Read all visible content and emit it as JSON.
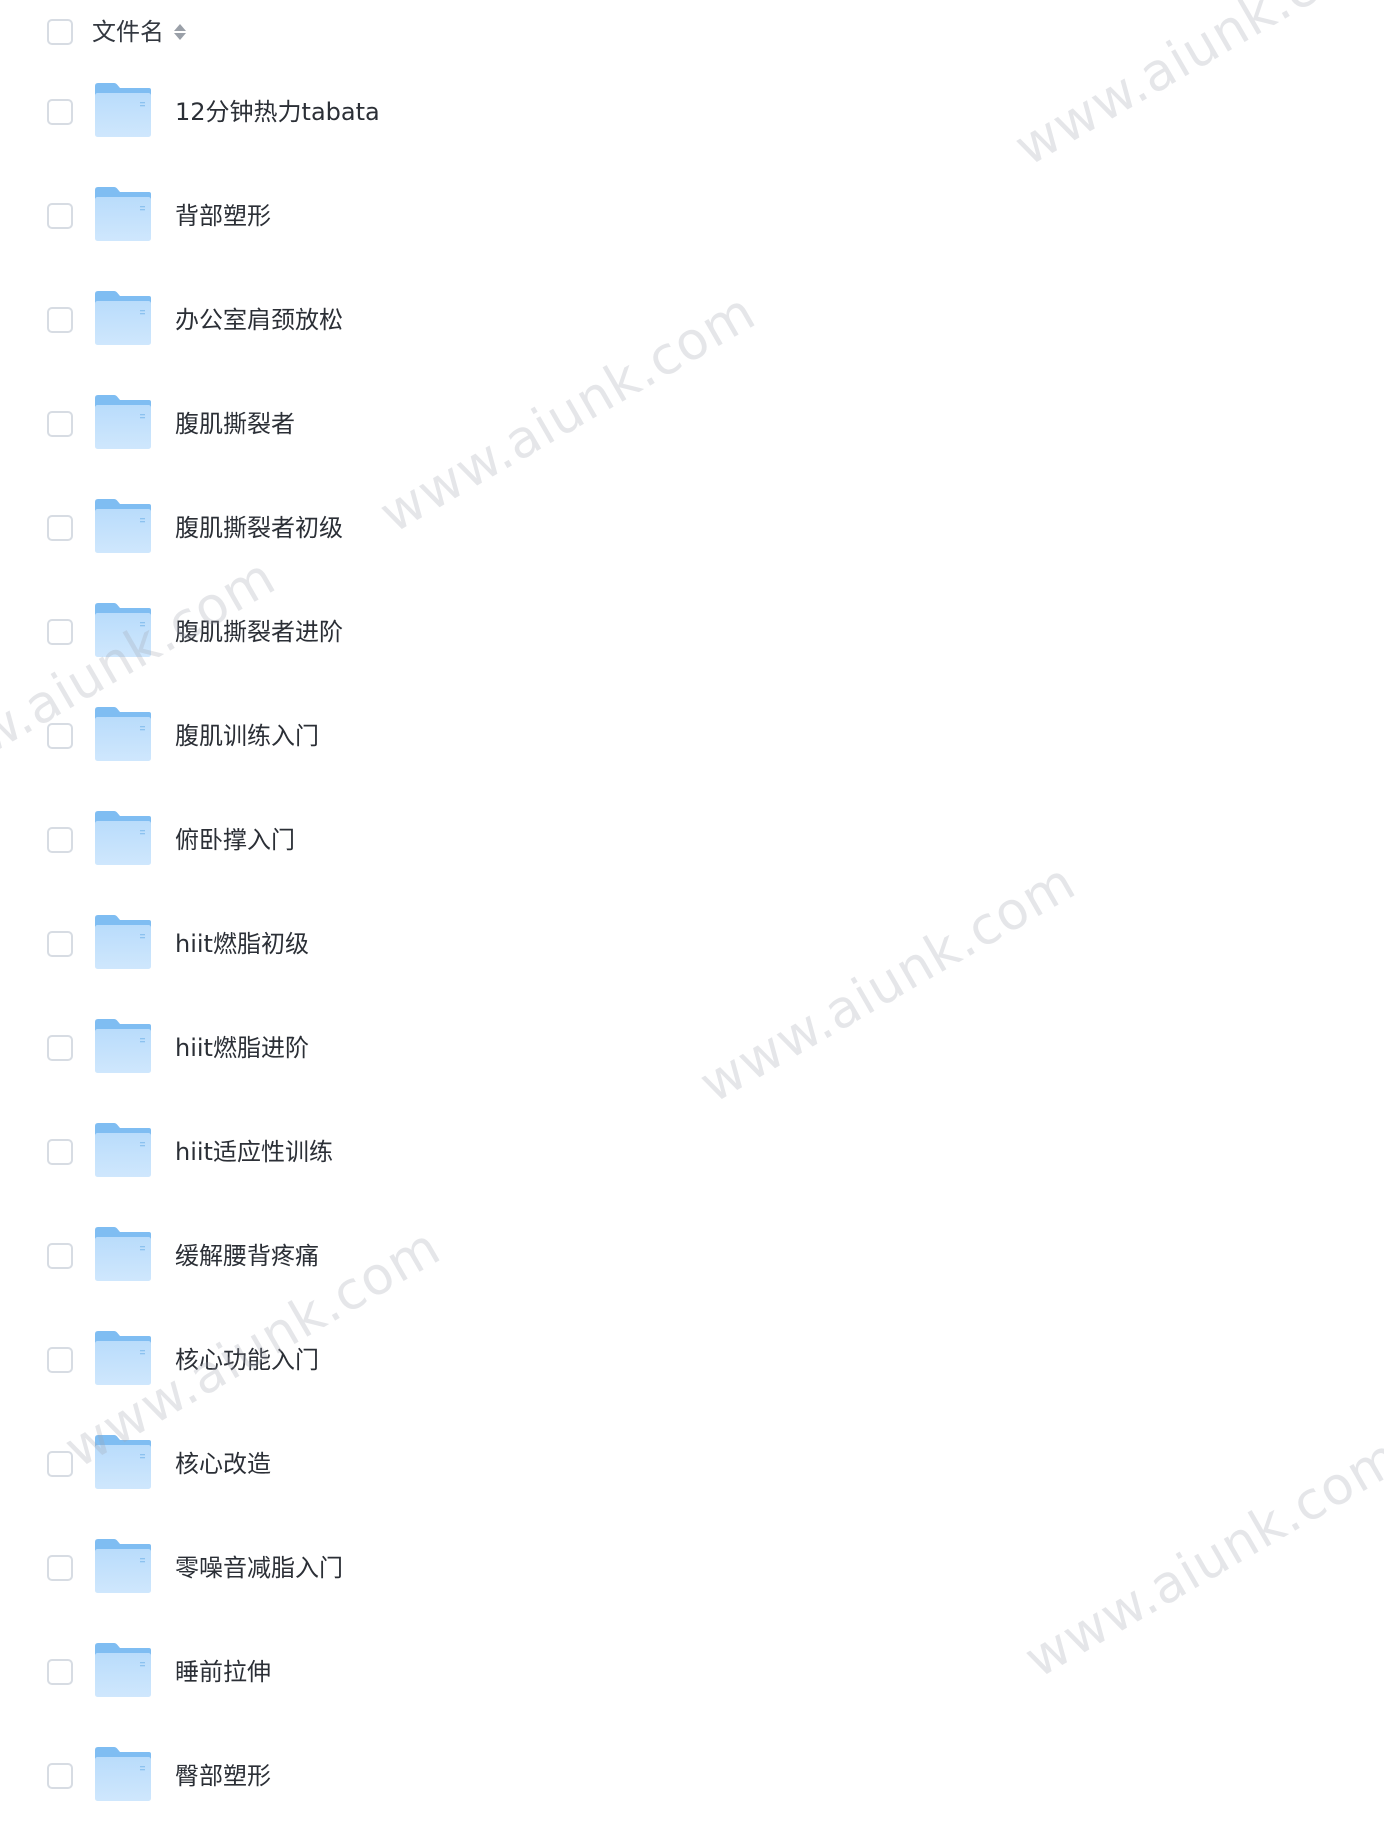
{
  "header": {
    "column_label": "文件名",
    "select_all_checked": false
  },
  "rows": [
    {
      "name": "12分钟热力tabata",
      "type": "folder"
    },
    {
      "name": "背部塑形",
      "type": "folder"
    },
    {
      "name": "办公室肩颈放松",
      "type": "folder"
    },
    {
      "name": "腹肌撕裂者",
      "type": "folder"
    },
    {
      "name": "腹肌撕裂者初级",
      "type": "folder"
    },
    {
      "name": "腹肌撕裂者进阶",
      "type": "folder"
    },
    {
      "name": "腹肌训练入门",
      "type": "folder"
    },
    {
      "name": "俯卧撑入门",
      "type": "folder"
    },
    {
      "name": "hiit燃脂初级",
      "type": "folder"
    },
    {
      "name": "hiit燃脂进阶",
      "type": "folder"
    },
    {
      "name": "hiit适应性训练",
      "type": "folder"
    },
    {
      "name": "缓解腰背疼痛",
      "type": "folder"
    },
    {
      "name": "核心功能入门",
      "type": "folder"
    },
    {
      "name": "核心改造",
      "type": "folder"
    },
    {
      "name": "零噪音减脂入门",
      "type": "folder"
    },
    {
      "name": "睡前拉伸",
      "type": "folder"
    },
    {
      "name": "臀部塑形",
      "type": "folder"
    }
  ],
  "watermark_text": "www.aiunk.com",
  "colors": {
    "folder_light": "#b9dcfb",
    "folder_dark": "#7fbdf2",
    "checkbox_border": "#d7dce3",
    "text": "#2b2f36"
  },
  "icons": {
    "folder": "folder-icon",
    "sort": "sort-icon"
  }
}
